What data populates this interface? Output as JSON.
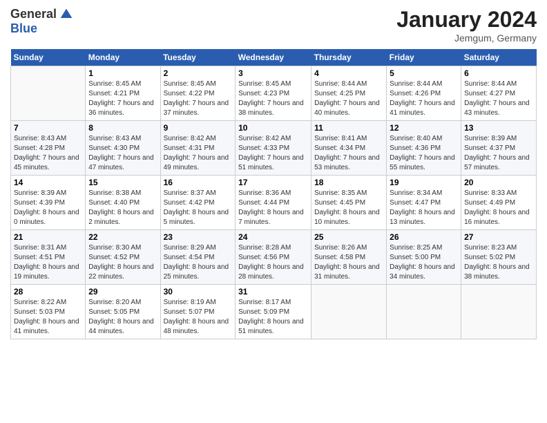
{
  "header": {
    "logo_general": "General",
    "logo_blue": "Blue",
    "month_year": "January 2024",
    "location": "Jemgum, Germany"
  },
  "days_of_week": [
    "Sunday",
    "Monday",
    "Tuesday",
    "Wednesday",
    "Thursday",
    "Friday",
    "Saturday"
  ],
  "weeks": [
    [
      {
        "day": "",
        "sunrise": "",
        "sunset": "",
        "daylight": ""
      },
      {
        "day": "1",
        "sunrise": "Sunrise: 8:45 AM",
        "sunset": "Sunset: 4:21 PM",
        "daylight": "Daylight: 7 hours and 36 minutes."
      },
      {
        "day": "2",
        "sunrise": "Sunrise: 8:45 AM",
        "sunset": "Sunset: 4:22 PM",
        "daylight": "Daylight: 7 hours and 37 minutes."
      },
      {
        "day": "3",
        "sunrise": "Sunrise: 8:45 AM",
        "sunset": "Sunset: 4:23 PM",
        "daylight": "Daylight: 7 hours and 38 minutes."
      },
      {
        "day": "4",
        "sunrise": "Sunrise: 8:44 AM",
        "sunset": "Sunset: 4:25 PM",
        "daylight": "Daylight: 7 hours and 40 minutes."
      },
      {
        "day": "5",
        "sunrise": "Sunrise: 8:44 AM",
        "sunset": "Sunset: 4:26 PM",
        "daylight": "Daylight: 7 hours and 41 minutes."
      },
      {
        "day": "6",
        "sunrise": "Sunrise: 8:44 AM",
        "sunset": "Sunset: 4:27 PM",
        "daylight": "Daylight: 7 hours and 43 minutes."
      }
    ],
    [
      {
        "day": "7",
        "sunrise": "Sunrise: 8:43 AM",
        "sunset": "Sunset: 4:28 PM",
        "daylight": "Daylight: 7 hours and 45 minutes."
      },
      {
        "day": "8",
        "sunrise": "Sunrise: 8:43 AM",
        "sunset": "Sunset: 4:30 PM",
        "daylight": "Daylight: 7 hours and 47 minutes."
      },
      {
        "day": "9",
        "sunrise": "Sunrise: 8:42 AM",
        "sunset": "Sunset: 4:31 PM",
        "daylight": "Daylight: 7 hours and 49 minutes."
      },
      {
        "day": "10",
        "sunrise": "Sunrise: 8:42 AM",
        "sunset": "Sunset: 4:33 PM",
        "daylight": "Daylight: 7 hours and 51 minutes."
      },
      {
        "day": "11",
        "sunrise": "Sunrise: 8:41 AM",
        "sunset": "Sunset: 4:34 PM",
        "daylight": "Daylight: 7 hours and 53 minutes."
      },
      {
        "day": "12",
        "sunrise": "Sunrise: 8:40 AM",
        "sunset": "Sunset: 4:36 PM",
        "daylight": "Daylight: 7 hours and 55 minutes."
      },
      {
        "day": "13",
        "sunrise": "Sunrise: 8:39 AM",
        "sunset": "Sunset: 4:37 PM",
        "daylight": "Daylight: 7 hours and 57 minutes."
      }
    ],
    [
      {
        "day": "14",
        "sunrise": "Sunrise: 8:39 AM",
        "sunset": "Sunset: 4:39 PM",
        "daylight": "Daylight: 8 hours and 0 minutes."
      },
      {
        "day": "15",
        "sunrise": "Sunrise: 8:38 AM",
        "sunset": "Sunset: 4:40 PM",
        "daylight": "Daylight: 8 hours and 2 minutes."
      },
      {
        "day": "16",
        "sunrise": "Sunrise: 8:37 AM",
        "sunset": "Sunset: 4:42 PM",
        "daylight": "Daylight: 8 hours and 5 minutes."
      },
      {
        "day": "17",
        "sunrise": "Sunrise: 8:36 AM",
        "sunset": "Sunset: 4:44 PM",
        "daylight": "Daylight: 8 hours and 7 minutes."
      },
      {
        "day": "18",
        "sunrise": "Sunrise: 8:35 AM",
        "sunset": "Sunset: 4:45 PM",
        "daylight": "Daylight: 8 hours and 10 minutes."
      },
      {
        "day": "19",
        "sunrise": "Sunrise: 8:34 AM",
        "sunset": "Sunset: 4:47 PM",
        "daylight": "Daylight: 8 hours and 13 minutes."
      },
      {
        "day": "20",
        "sunrise": "Sunrise: 8:33 AM",
        "sunset": "Sunset: 4:49 PM",
        "daylight": "Daylight: 8 hours and 16 minutes."
      }
    ],
    [
      {
        "day": "21",
        "sunrise": "Sunrise: 8:31 AM",
        "sunset": "Sunset: 4:51 PM",
        "daylight": "Daylight: 8 hours and 19 minutes."
      },
      {
        "day": "22",
        "sunrise": "Sunrise: 8:30 AM",
        "sunset": "Sunset: 4:52 PM",
        "daylight": "Daylight: 8 hours and 22 minutes."
      },
      {
        "day": "23",
        "sunrise": "Sunrise: 8:29 AM",
        "sunset": "Sunset: 4:54 PM",
        "daylight": "Daylight: 8 hours and 25 minutes."
      },
      {
        "day": "24",
        "sunrise": "Sunrise: 8:28 AM",
        "sunset": "Sunset: 4:56 PM",
        "daylight": "Daylight: 8 hours and 28 minutes."
      },
      {
        "day": "25",
        "sunrise": "Sunrise: 8:26 AM",
        "sunset": "Sunset: 4:58 PM",
        "daylight": "Daylight: 8 hours and 31 minutes."
      },
      {
        "day": "26",
        "sunrise": "Sunrise: 8:25 AM",
        "sunset": "Sunset: 5:00 PM",
        "daylight": "Daylight: 8 hours and 34 minutes."
      },
      {
        "day": "27",
        "sunrise": "Sunrise: 8:23 AM",
        "sunset": "Sunset: 5:02 PM",
        "daylight": "Daylight: 8 hours and 38 minutes."
      }
    ],
    [
      {
        "day": "28",
        "sunrise": "Sunrise: 8:22 AM",
        "sunset": "Sunset: 5:03 PM",
        "daylight": "Daylight: 8 hours and 41 minutes."
      },
      {
        "day": "29",
        "sunrise": "Sunrise: 8:20 AM",
        "sunset": "Sunset: 5:05 PM",
        "daylight": "Daylight: 8 hours and 44 minutes."
      },
      {
        "day": "30",
        "sunrise": "Sunrise: 8:19 AM",
        "sunset": "Sunset: 5:07 PM",
        "daylight": "Daylight: 8 hours and 48 minutes."
      },
      {
        "day": "31",
        "sunrise": "Sunrise: 8:17 AM",
        "sunset": "Sunset: 5:09 PM",
        "daylight": "Daylight: 8 hours and 51 minutes."
      },
      {
        "day": "",
        "sunrise": "",
        "sunset": "",
        "daylight": ""
      },
      {
        "day": "",
        "sunrise": "",
        "sunset": "",
        "daylight": ""
      },
      {
        "day": "",
        "sunrise": "",
        "sunset": "",
        "daylight": ""
      }
    ]
  ]
}
